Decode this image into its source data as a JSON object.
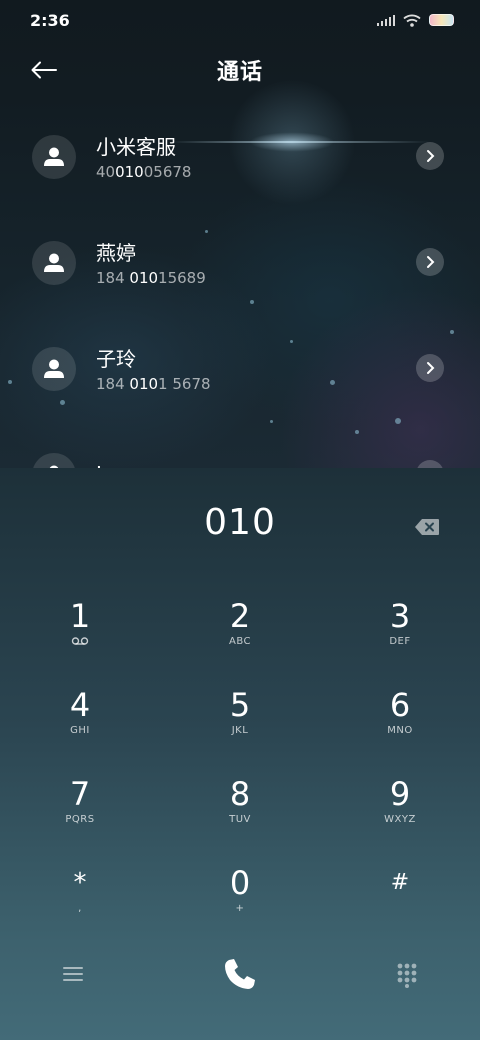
{
  "status_bar": {
    "time": "2:36",
    "icons": [
      "signal-icon",
      "wifi-icon",
      "battery-icon"
    ]
  },
  "header": {
    "title": "通话",
    "back_icon": "arrow-left-icon"
  },
  "contacts": [
    {
      "name": "小米客服",
      "number_parts": [
        "40",
        "010",
        "05678"
      ],
      "icon": "person-icon",
      "action_icon": "chevron-right-icon"
    },
    {
      "name": "燕婷",
      "number_parts": [
        "184 ",
        "010",
        "15689"
      ],
      "icon": "person-icon",
      "action_icon": "chevron-right-icon"
    },
    {
      "name": "子玲",
      "number_parts": [
        "184 ",
        "010",
        "1 5678"
      ],
      "icon": "person-icon",
      "action_icon": "chevron-right-icon"
    },
    {
      "name": "Jason",
      "number_parts": [
        "",
        "",
        ""
      ],
      "icon": "person-icon",
      "action_icon": "chevron-right-icon"
    }
  ],
  "dialpad": {
    "display": "010",
    "backspace_icon": "backspace-icon",
    "keys": [
      {
        "digit": "1",
        "letters": "",
        "icon": "voicemail-icon"
      },
      {
        "digit": "2",
        "letters": "ABC"
      },
      {
        "digit": "3",
        "letters": "DEF"
      },
      {
        "digit": "4",
        "letters": "GHI"
      },
      {
        "digit": "5",
        "letters": "JKL"
      },
      {
        "digit": "6",
        "letters": "MNO"
      },
      {
        "digit": "7",
        "letters": "PQRS"
      },
      {
        "digit": "8",
        "letters": "TUV"
      },
      {
        "digit": "9",
        "letters": "WXYZ"
      },
      {
        "digit": "*",
        "letters": ","
      },
      {
        "digit": "0",
        "letters": "+"
      },
      {
        "digit": "#",
        "letters": ""
      }
    ],
    "bottom_icons": [
      "menu-icon",
      "phone-call-icon",
      "keypad-icon"
    ]
  },
  "colors": {
    "dialpad_top": "#1d3039",
    "dialpad_bottom": "#436b78",
    "background_dark": "#111a1f"
  }
}
